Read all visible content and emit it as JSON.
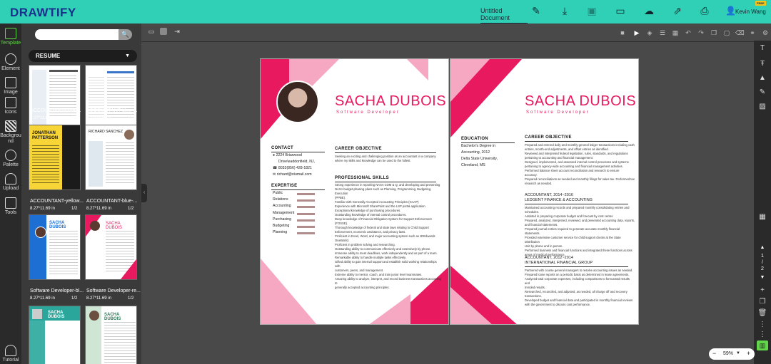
{
  "app": {
    "logo": "DRAWTIFY",
    "doc_title": "Untitled Document",
    "free_badge": "FREE",
    "user_name": "Kevin Wang"
  },
  "topbar": {
    "icons": [
      "pencil-icon",
      "download-icon",
      "save-icon",
      "present-icon",
      "cloud-icon",
      "share-icon",
      "print-icon",
      "user-icon"
    ]
  },
  "rail": {
    "items": [
      {
        "label": "Template",
        "icon": "template-icon",
        "active": true
      },
      {
        "label": "Element",
        "icon": "element-icon"
      },
      {
        "label": "Image",
        "icon": "image-icon"
      },
      {
        "label": "Icons",
        "icon": "icons-icon"
      },
      {
        "label": "Background",
        "icon": "background-icon"
      },
      {
        "label": "Palette",
        "icon": "palette-icon"
      },
      {
        "label": "Upload",
        "icon": "upload-icon"
      },
      {
        "label": "Tools",
        "icon": "tools-icon"
      },
      {
        "label": "Tutorial",
        "icon": "tutorial-icon"
      }
    ]
  },
  "panel": {
    "search_placeholder": "",
    "category": "RESUME",
    "templates": [
      {
        "name": "ACCOUNTANT-blue-...",
        "meta": "8.27*11.69 in",
        "pages": "1/2"
      },
      {
        "name": "ACCOUNTANT-blue-...",
        "meta": "8.27*11.69 in",
        "pages": "1/2"
      },
      {
        "name": "ACCOUNTANT-yellow...",
        "meta": "8.27*11.69 in",
        "pages": "1/2"
      },
      {
        "name": "ACCOUNTANT-blue-...",
        "meta": "8.27*11.69 in",
        "pages": "1/2"
      },
      {
        "name": "Software Developer-bl...",
        "meta": "8.27*11.69 in",
        "pages": "1/2"
      },
      {
        "name": "Software Developer-re...",
        "meta": "8.27*11.69 in",
        "pages": "1/2"
      },
      {
        "name": "",
        "meta": "",
        "pages": ""
      },
      {
        "name": "",
        "meta": "",
        "pages": ""
      }
    ],
    "thumb_texts": {
      "yellow_name": "JONATHAN PATTERSON",
      "richard": "RICHARD SANCHEZ",
      "sacha": "SACHA DUBOIS"
    }
  },
  "resume": {
    "name": "SACHA DUBOIS",
    "role": "Software Developer",
    "contact_h": "CONTACT",
    "contact": [
      "2224 Briarwood",
      "Drive\\eaddonfield, NJ,",
      "8033(856) 428-1821",
      "richard@stumail.com"
    ],
    "expertise_h": "EXPERTISE",
    "expertise": [
      {
        "label": "Public",
        "level": 0.9
      },
      {
        "label": "Relations",
        "level": 0.9
      },
      {
        "label": "Accounting",
        "level": 0.9
      },
      {
        "label": "Management",
        "level": 0.9
      },
      {
        "label": "Purchasing",
        "level": 0.9
      },
      {
        "label": "Budgeting",
        "level": 0.9
      },
      {
        "label": "Planning",
        "level": 0.9
      }
    ],
    "career_h": "CAREER OBJECTIVE",
    "career_text": "Seeking an exciting and challenging position as an accountant in a company where my skills and knowledge can be used to the fullest.",
    "skills_h": "PROFESSIONAL SKILLS",
    "skills": [
      "Strong experience in reporting NASA COM & Q, and developing and     presenting",
      "NASA budget-phasing plans such as Planning, Programming, Budgeting, Execution",
      "(PPBE).",
      "Familiar with Generally Accepted Accounting Principles (GAAP)",
      "Experience with Microsoft SharePoint and the LSP portal application.",
      "Exceptional knowledge of purchasing procedures.",
      "Outstanding knowledge of internal control procedures.",
      "Deep knowledge of Financial Obligation System for Support Enforcement (FOSSE).",
      "Thorough knowledge of federal and state laws relating to Child    Support",
      "Enforcement, economic assistance, and privacy laws.",
      "Proficient in Excel, Word, and major accounting system such as JDEdwards",
      "OneWorld.",
      "Proficient in problem solving and researching.",
      "Outstanding ability to communicate effectively and extensively by phone.",
      "Immense ability to meet deadlines, work independently and as part       of a team.",
      "Remarkable ability to handle multiple tasks effectively.",
      "Gifted ability to gain internal support and establish solid working relationships with",
      "customers, peers, and management.",
      "Extreme ability to mentor, coach, and train junior level teammates.",
      "Amazing ability to analyze, interpret, and record business transactions according to",
      "generally accepted accounting principles."
    ],
    "page2": {
      "education_h": "EDUCATION",
      "education": [
        "Bachelor's Degree in",
        "Accounting, 2012",
        "Delta State University,",
        "Cleveland, MS"
      ],
      "career_h": "CAREER OBJECTIVE",
      "career_lines": [
        "Prepared and entered daily and monthly general ledger transactions including cash",
        "entries, month-end adjustments, and offset entries as identified.",
        "Reviewed and interpreted federal legislation, rules, standards, and regulations",
        "pertaining to accounting and financial management.",
        "Designed, implemented, and assessed internal control processes and systems",
        "pertaining to agency-wide accounting and financial management activities.",
        "Performed balance sheet account reconciliation and research to       ensure",
        "accuracy.",
        "Prepared reconciliations as needed and monthly filings for sales tax. Performed tax",
        "research as needed."
      ],
      "job1_title": "ACCOUNTANT, 2014~2016",
      "job1_company": "LEDGENT FINANCE & ACCOUNTING",
      "job1_lines": [
        "Maintained accounting records and prepared monthly consolidating entries and",
        "schedules.",
        "Assisted in preparing corporate budget and forecast by cost center.",
        "Prepared, analyzed, interpreted, reviewed, and presented accounting data, reports,",
        "and financial statements.",
        "Prepared journal entries required to generate accurate monthly financial statements.",
        "Provided extensive customer service for child support clients at the State Distribution",
        "Unit by phone and in person.",
        "Performed business and financial functions and integrated these functions across",
        "areas of medical performance."
      ],
      "job2_title": "ACCOUNTANT, 2012~2014",
      "job2_company": "INTERNATIONAL FINANCIAL GROUP",
      "job2_lines": [
        "Partnered with course general managers to resolve accounting issues as needed.",
        "Prepared loose reports on a periodic basis as determined in lease agreements.",
        "Analyzed total corporate expenses, including comparisons to forecasted results and",
        "trended results.",
        "Researched, reconciled, and adjusted, as needed, all charge off and recovery",
        "transactions.",
        "Developed budget and financial data and participated in monthly financial reviews",
        "with the government to discuss cost performance."
      ]
    }
  },
  "right_rail": {
    "page_up": "▲",
    "page_current": "1",
    "page_sep": "/",
    "page_total": "2",
    "page_down": "▼"
  },
  "zoom": {
    "minus": "−",
    "value": "59%",
    "caret": "▼",
    "plus": "+"
  },
  "colors": {
    "accent_teal": "#2fd0b5",
    "brand_blue": "#1a2f8c",
    "resume_pink": "#e8195f",
    "resume_light_pink": "#f6a8c2",
    "active_green": "#62d64a"
  }
}
